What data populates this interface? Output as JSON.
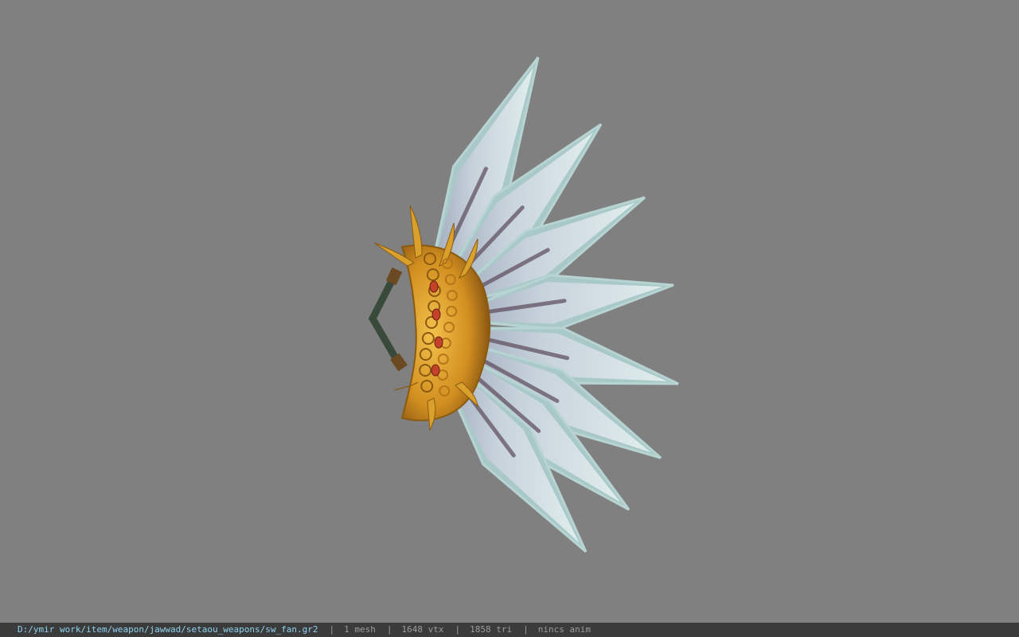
{
  "viewer": {
    "background_color": "#808080",
    "model_subject": "ornate fan weapon (sw_fan)",
    "model_colors": {
      "blade": "#d8e6e6",
      "blade_edge": "#a9c9c9",
      "blade_inner": "#c7cfd8",
      "gold": "#d9a12c",
      "gold_dark": "#8a5a12",
      "gem": "#c4422a",
      "handle": "#3a4a3a"
    }
  },
  "statusbar": {
    "file_path": "D:/ymir work/item/weapon/jawwad/setaou_weapons/sw_fan.gr2",
    "separator": "|",
    "mesh_count": "1 mesh",
    "vertex_count": "1648 vtx",
    "triangle_count": "1858 tri",
    "animation": "nincs anim",
    "path_color": "#8fd3f0",
    "text_color": "#9c9c9c",
    "background_color": "#3b3b3b"
  }
}
